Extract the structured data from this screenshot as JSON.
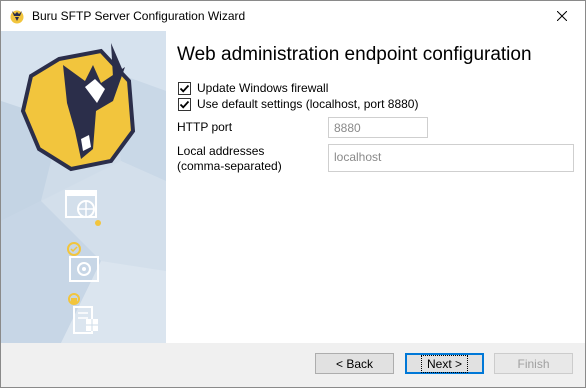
{
  "window": {
    "title": "Buru SFTP Server Configuration Wizard"
  },
  "main": {
    "heading": "Web administration endpoint configuration",
    "checkboxes": [
      {
        "label": "Update Windows firewall",
        "checked": true
      },
      {
        "label": "Use default settings (localhost, port 8880)",
        "checked": true
      }
    ],
    "http_port": {
      "label": "HTTP port",
      "value": "8880"
    },
    "local_addresses": {
      "label_line1": "Local addresses",
      "label_line2": "(comma-separated)",
      "value": "localhost"
    }
  },
  "footer": {
    "back_label": "< Back",
    "next_label": "Next >",
    "finish_label": "Finish"
  },
  "colors": {
    "sidebar": "#cfdce9",
    "logo_gold": "#f2c53d",
    "logo_dark": "#2b2e4a"
  }
}
